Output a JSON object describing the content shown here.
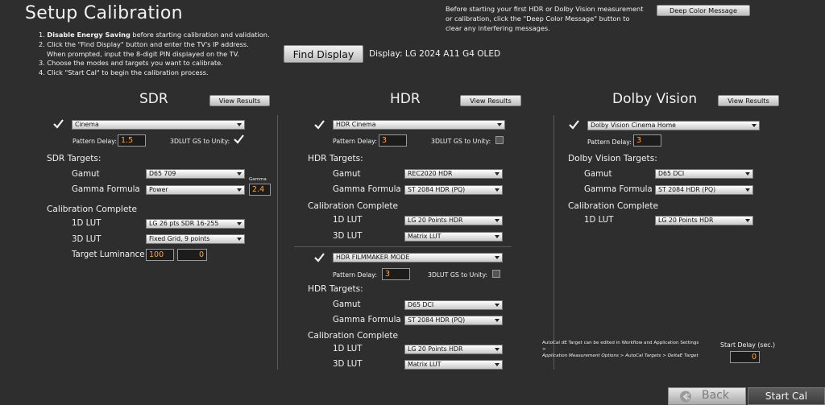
{
  "page": {
    "title": "Setup Calibration"
  },
  "instructions": {
    "step1_bold": "Disable Energy Saving",
    "step1_rest": " before starting calibration and validation.",
    "step1_num": "1. ",
    "step2": "2. Click the \"Find Display\" button and enter the TV's IP address.",
    "step2b": "When prompted, input the 8-digit PIN displayed on the TV.",
    "step3": "3. Choose the modes and targets you want to calibrate.",
    "step4": "4. Click \"Start Cal\" to begin the calibration process."
  },
  "deep_color": {
    "text1": "Before starting your first HDR or Dolby Vision measurement",
    "text2": "or calibration, click the \"Deep Color Message\" button to",
    "text3": "clear any interfering messages.",
    "button": "Deep Color Message"
  },
  "find_display": {
    "button": "Find Display",
    "display_label": "Display: LG 2024 A11 G4 OLED"
  },
  "sdr": {
    "title": "SDR",
    "view_results": "View Results",
    "mode": "Cinema",
    "pattern_delay_label": "Pattern Delay:",
    "pattern_delay": "1.5",
    "lut_unity_label": "3DLUT GS to Unity:",
    "targets_label": "SDR Targets:",
    "gamut_label": "Gamut",
    "gamut": "D65  709",
    "gamma_formula_label": "Gamma Formula",
    "gamma_formula": "Power",
    "gamma_small_label": "Gamma",
    "gamma_value": "2.4",
    "cal_complete_label": "Calibration Complete",
    "lut1d_label": "1D LUT",
    "lut1d": "LG 26 pts SDR 16-255",
    "lut3d_label": "3D LUT",
    "lut3d": "Fixed Grid, 9 points",
    "target_lum_label": "Target Luminance",
    "target_lum": "100",
    "target_lum2": "0"
  },
  "hdr": {
    "title": "HDR",
    "view_results": "View Results",
    "mode": "HDR Cinema",
    "pattern_delay_label": "Pattern Delay:",
    "pattern_delay": "3",
    "lut_unity_label": "3DLUT GS to Unity:",
    "targets_label": "HDR Targets:",
    "gamut_label": "Gamut",
    "gamut": "REC2020  HDR",
    "gamma_formula_label": "Gamma Formula",
    "gamma_formula": "ST 2084 HDR (PQ)",
    "cal_complete_label": "Calibration Complete",
    "lut1d_label": "1D LUT",
    "lut1d": "LG 20 Points HDR",
    "lut3d_label": "3D LUT",
    "lut3d": "Matrix LUT",
    "fm_mode": "HDR FILMMAKER MODE",
    "fm_pattern_delay_label": "Pattern Delay:",
    "fm_pattern_delay": "3",
    "fm_lut_unity_label": "3DLUT GS to Unity:",
    "fm_targets_label": "HDR Targets:",
    "fm_gamut_label": "Gamut",
    "fm_gamut": "D65  DCI",
    "fm_gamma_formula_label": "Gamma Formula",
    "fm_gamma_formula": "ST 2084 HDR (PQ)",
    "fm_cal_complete_label": "Calibration Complete",
    "fm_lut1d_label": "1D LUT",
    "fm_lut1d": "LG 20 Points HDR",
    "fm_lut3d_label": "3D LUT",
    "fm_lut3d": "Matrix LUT"
  },
  "dolby": {
    "title": "Dolby Vision",
    "view_results": "View Results",
    "mode": "Dolby Vision Cinema Home",
    "pattern_delay_label": "Pattern Delay:",
    "pattern_delay": "3",
    "targets_label": "Dolby Vision Targets:",
    "gamut_label": "Gamut",
    "gamut": "D65  DCI",
    "gamma_formula_label": "Gamma Formula",
    "gamma_formula": "ST 2084 HDR (PQ)",
    "cal_complete_label": "Calibration Complete",
    "lut1d_label": "1D LUT",
    "lut1d": "LG 20 Points HDR"
  },
  "footer": {
    "note1": "AutoCal dE Target can be edited in Workflow and Application Settings >",
    "note2": "Application Measurement Options > AutoCal Targets > DeltaE Target",
    "start_delay_label": "Start Delay (sec.)",
    "start_delay": "0",
    "back": "Back",
    "start_cal": "Start Cal"
  },
  "colors": {
    "background": "#2e2e2e",
    "value_text": "#ffa53a"
  },
  "icons": {
    "check": "check-icon",
    "back": "back-arrow-icon",
    "dropdown": "chevron-down-icon"
  }
}
